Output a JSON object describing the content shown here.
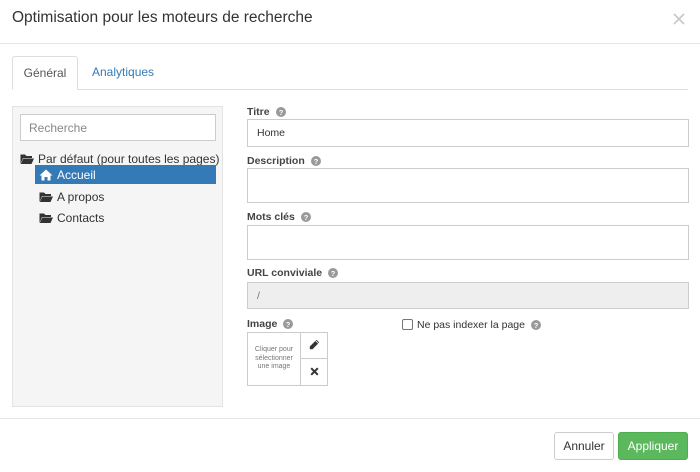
{
  "dialog": {
    "title": "Optimisation pour les moteurs de recherche"
  },
  "tabs": [
    {
      "label": "Général",
      "active": true
    },
    {
      "label": "Analytiques",
      "active": false
    }
  ],
  "tree": {
    "search_placeholder": "Recherche",
    "root_label": "Par défaut (pour toutes les pages)",
    "items": [
      {
        "label": "Accueil",
        "icon": "home-icon",
        "selected": true
      },
      {
        "label": "A propos",
        "icon": "folder-open-icon",
        "selected": false
      },
      {
        "label": "Contacts",
        "icon": "folder-open-icon",
        "selected": false
      }
    ]
  },
  "form": {
    "title_label": "Titre",
    "title_value": "Home",
    "description_label": "Description",
    "description_value": "",
    "keywords_label": "Mots clés",
    "keywords_value": "",
    "url_label": "URL conviviale",
    "url_value": "/",
    "image_label": "Image",
    "image_placeholder": "Cliquer pour sélectionner une image",
    "noindex_label": "Ne pas indexer la page",
    "noindex_checked": false
  },
  "footer": {
    "cancel_label": "Annuler",
    "apply_label": "Appliquer"
  },
  "colors": {
    "accent": "#337ab7",
    "apply_button": "#5cb85c",
    "panel_bg": "#f5f5f5"
  }
}
